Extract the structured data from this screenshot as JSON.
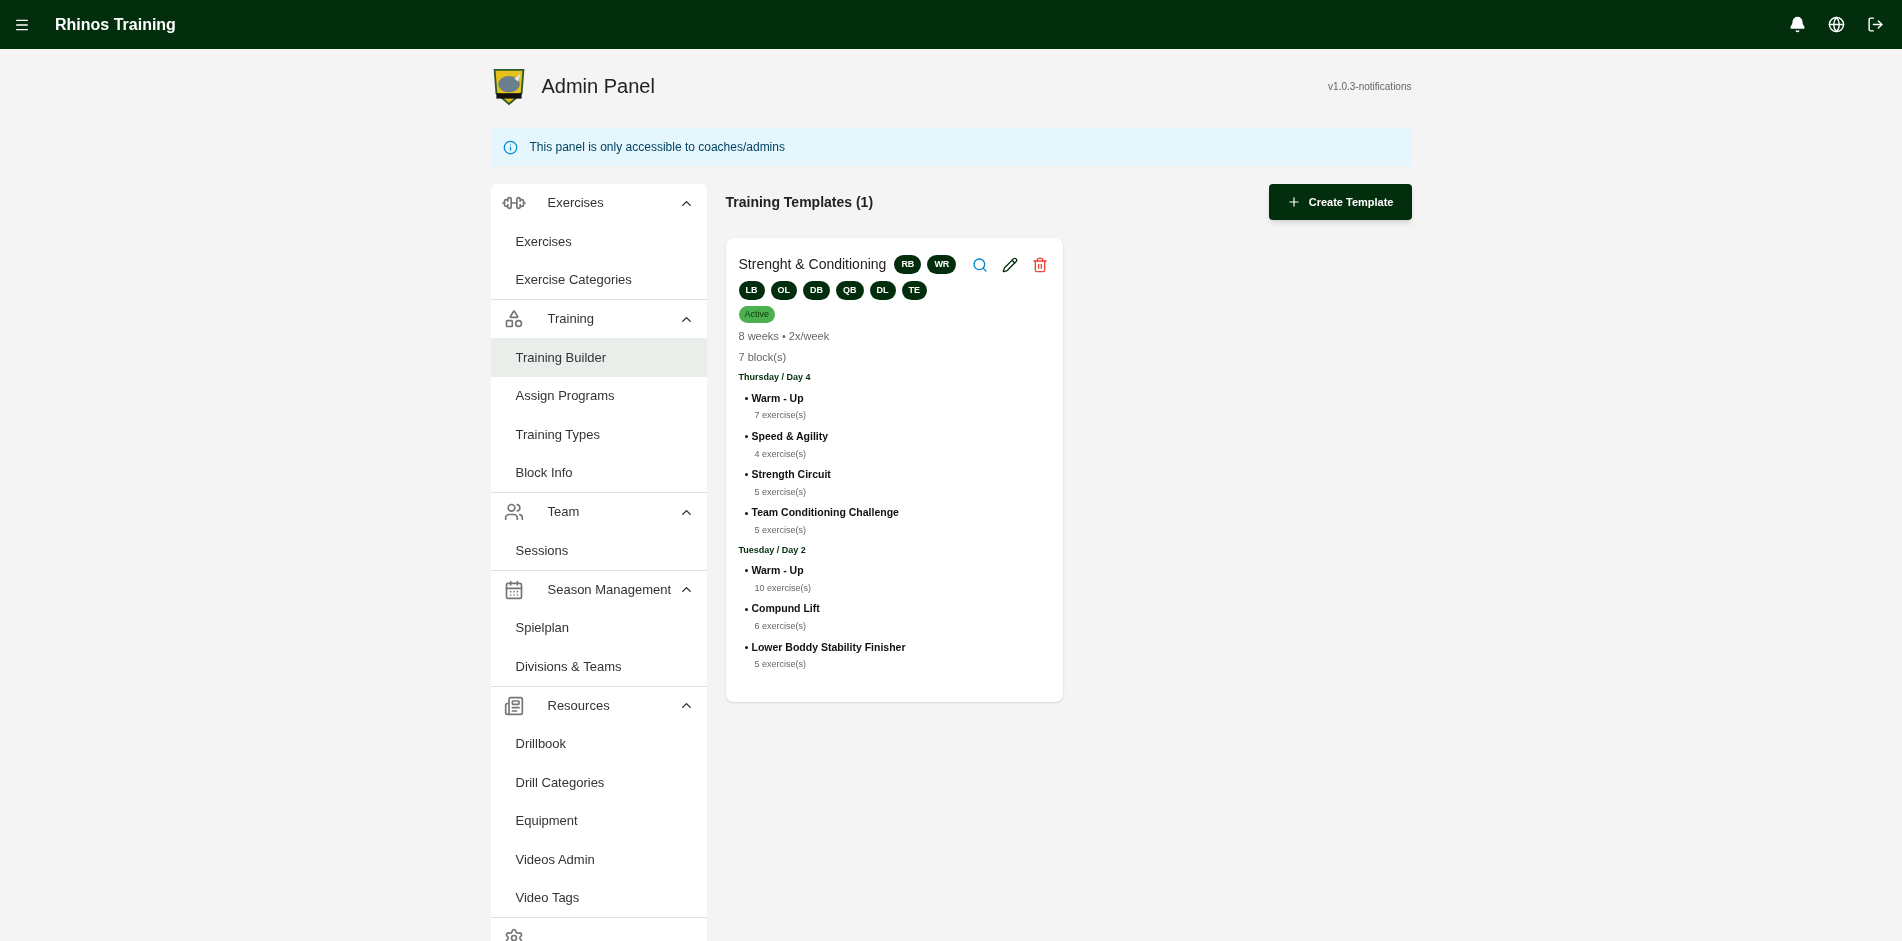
{
  "app_bar": {
    "title": "Rhinos Training"
  },
  "page": {
    "title": "Admin Panel",
    "version": "v1.0.3-notifications"
  },
  "info_alert": {
    "text": "This panel is only accessible to coaches/admins"
  },
  "sidebar": {
    "sections": [
      {
        "kind": "exercises",
        "label": "Exercises",
        "expanded": true,
        "items": [
          {
            "label": "Exercises",
            "selected": false
          },
          {
            "label": "Exercise Categories",
            "selected": false
          }
        ]
      },
      {
        "kind": "training",
        "label": "Training",
        "expanded": true,
        "items": [
          {
            "label": "Training Builder",
            "selected": true
          },
          {
            "label": "Assign Programs",
            "selected": false
          },
          {
            "label": "Training Types",
            "selected": false
          },
          {
            "label": "Block Info",
            "selected": false
          }
        ]
      },
      {
        "kind": "team",
        "label": "Team",
        "expanded": true,
        "items": [
          {
            "label": "Sessions",
            "selected": false
          }
        ]
      },
      {
        "kind": "season",
        "label": "Season Management",
        "expanded": true,
        "items": [
          {
            "label": "Spielplan",
            "selected": false
          },
          {
            "label": "Divisions & Teams",
            "selected": false
          }
        ]
      },
      {
        "kind": "resources",
        "label": "Resources",
        "expanded": true,
        "items": [
          {
            "label": "Drillbook",
            "selected": false
          },
          {
            "label": "Drill Categories",
            "selected": false
          },
          {
            "label": "Equipment",
            "selected": false
          },
          {
            "label": "Videos Admin",
            "selected": false
          },
          {
            "label": "Video Tags",
            "selected": false
          }
        ]
      }
    ]
  },
  "main": {
    "title": "Training Templates (1)",
    "create_button": "Create Template",
    "templates": [
      {
        "name": "Strenght & Conditioning",
        "positions": [
          "RB",
          "WR",
          "LB",
          "OL",
          "DB",
          "QB",
          "DL",
          "TE"
        ],
        "active": true,
        "status": "Active",
        "schedule": "8 weeks • 2x/week",
        "blocks": "7 block(s)",
        "days": [
          {
            "title": "Thursday / Day 4",
            "blocks": [
              {
                "name": "Warm - Up",
                "count": "7 exercise(s)"
              },
              {
                "name": "Speed & Agility",
                "count": "4 exercise(s)"
              },
              {
                "name": "Strength Circuit",
                "count": "5 exercise(s)"
              },
              {
                "name": "Team Conditioning Challenge",
                "count": "5 exercise(s)"
              }
            ]
          },
          {
            "title": "Tuesday / Day 2",
            "blocks": [
              {
                "name": "Warm - Up",
                "count": "10 exercise(s)"
              },
              {
                "name": "Compund Lift",
                "count": "6 exercise(s)"
              },
              {
                "name": "Lower Boddy Stability Finisher",
                "count": "5 exercise(s)"
              }
            ]
          }
        ]
      }
    ]
  }
}
